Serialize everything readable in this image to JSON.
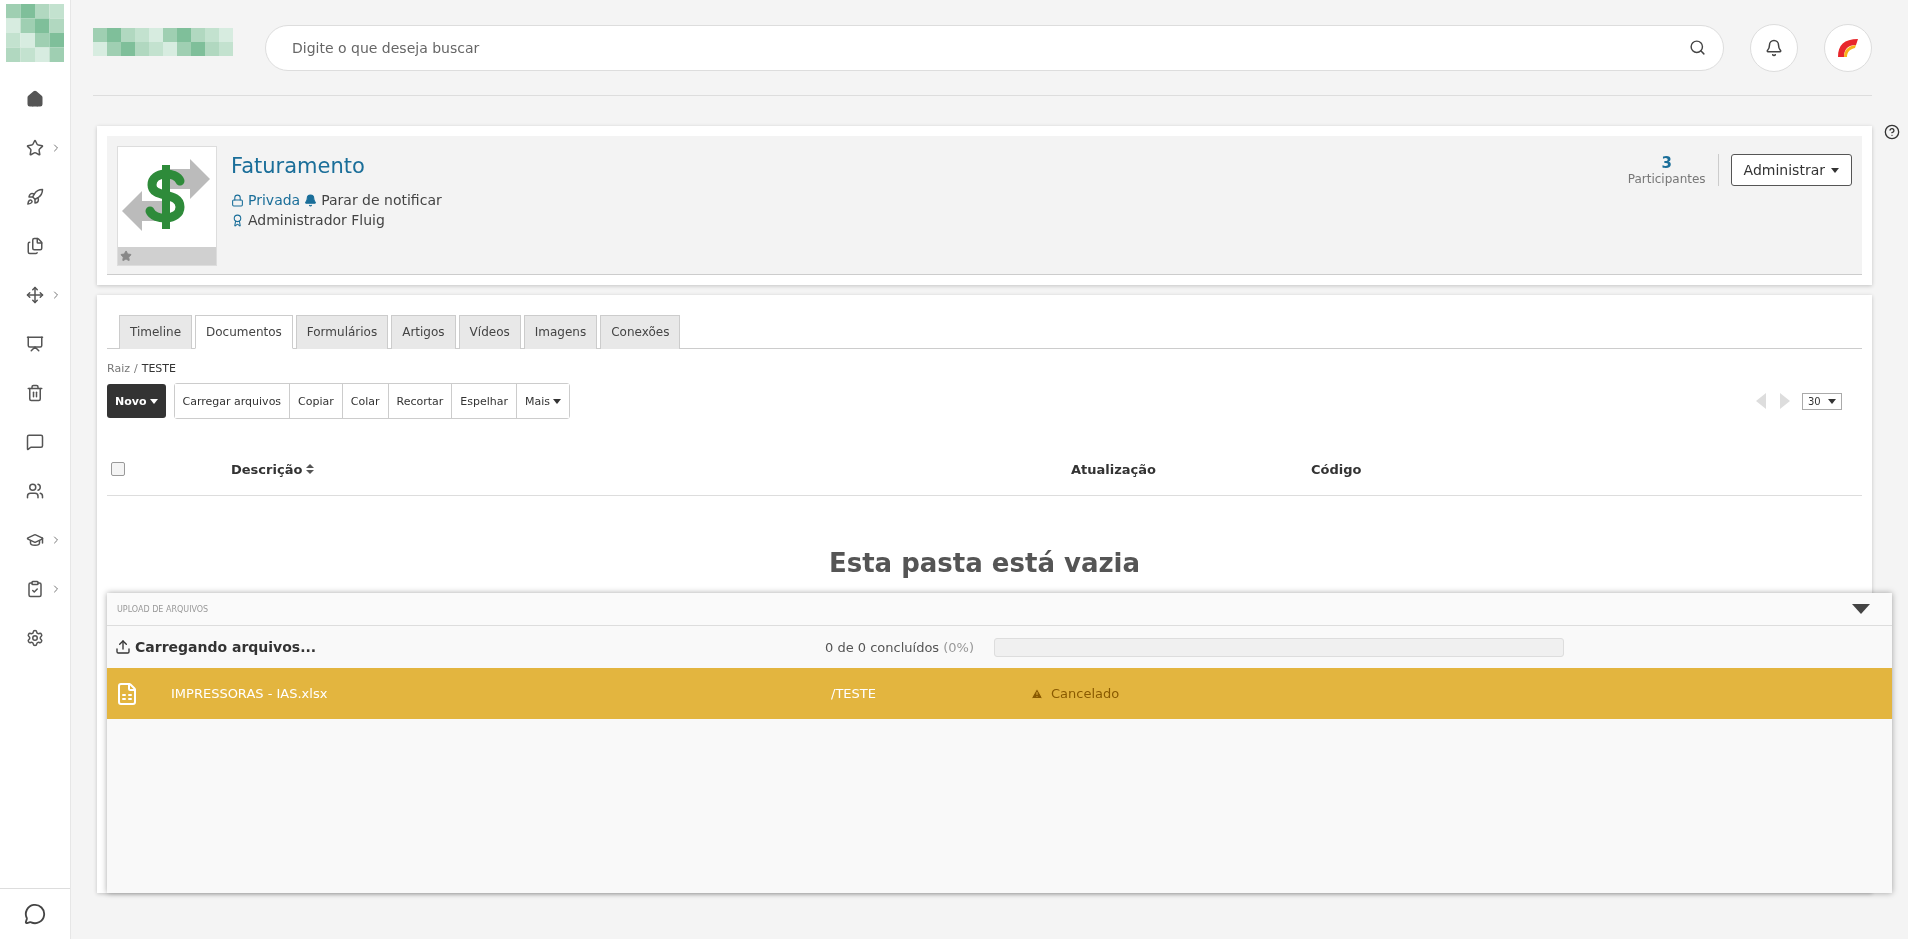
{
  "header": {
    "search": {
      "placeholder": "Digite o que deseja buscar"
    }
  },
  "sidebar": {
    "items": [
      {
        "expandable": false
      },
      {
        "expandable": true
      },
      {
        "expandable": false
      },
      {
        "expandable": false
      },
      {
        "expandable": true
      },
      {
        "expandable": false
      },
      {
        "expandable": false
      },
      {
        "expandable": false
      },
      {
        "expandable": false
      },
      {
        "expandable": true
      },
      {
        "expandable": true
      },
      {
        "expandable": false
      }
    ]
  },
  "community": {
    "title": "Faturamento",
    "privacy": "Privada",
    "notify": "Parar de notificar",
    "owner": "Administrador Fluig",
    "participants_count": "3",
    "participants_label": "Participantes",
    "admin_button": "Administrar"
  },
  "tabs": [
    {
      "label": "Timeline",
      "selected": false
    },
    {
      "label": "Documentos",
      "selected": true
    },
    {
      "label": "Formulários",
      "selected": false
    },
    {
      "label": "Artigos",
      "selected": false
    },
    {
      "label": "Vídeos",
      "selected": false
    },
    {
      "label": "Imagens",
      "selected": false
    },
    {
      "label": "Conexões",
      "selected": false
    }
  ],
  "breadcrumb": {
    "items": [
      "Raiz",
      "TESTE"
    ],
    "separator": "/"
  },
  "toolbar": [
    {
      "label": "Novo",
      "primary": true,
      "dropdown": true
    },
    {
      "label": "Carregar arquivos",
      "primary": false,
      "dropdown": false
    },
    {
      "label": "Copiar",
      "primary": false,
      "dropdown": false
    },
    {
      "label": "Colar",
      "primary": false,
      "dropdown": false
    },
    {
      "label": "Recortar",
      "primary": false,
      "dropdown": false
    },
    {
      "label": "Espelhar",
      "primary": false,
      "dropdown": false
    },
    {
      "label": "Mais",
      "primary": false,
      "dropdown": true
    }
  ],
  "pagination": {
    "page_size": "30"
  },
  "table": {
    "select_all_checked": false,
    "columns": [
      "Descrição",
      "Atualização",
      "Código"
    ],
    "empty_message": "Esta pasta está vazia"
  },
  "upload": {
    "title": "UPLOAD DE ARQUIVOS",
    "status": "Carregando arquivos...",
    "summary": "0 de 0 concluídos",
    "percent": "(0%)",
    "level": 0,
    "files": [
      {
        "name": "IMPRESSORAS - IAS.xlsx",
        "path": "/TESTE",
        "status": "Cancelado"
      }
    ]
  }
}
